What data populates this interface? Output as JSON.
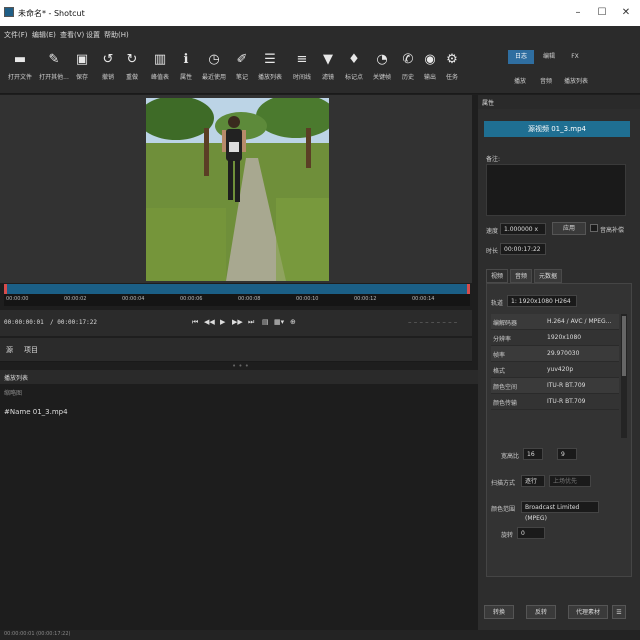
{
  "window": {
    "title": "未命名* - Shotcut"
  },
  "menu": [
    "文件(F)",
    "编辑(E)",
    "查看(V)",
    "设置",
    "帮助(H)"
  ],
  "toolbar": [
    {
      "label": "打开文件",
      "icon": "folder-icon"
    },
    {
      "label": "打开其他...",
      "icon": "open-other-icon"
    },
    {
      "label": "保存",
      "icon": "save-icon"
    },
    {
      "label": "撤销",
      "icon": "undo-icon"
    },
    {
      "label": "重做",
      "icon": "redo-icon"
    },
    {
      "label": "峰值表",
      "icon": "peak-meter-icon"
    },
    {
      "label": "属性",
      "icon": "info-icon"
    },
    {
      "label": "最近使用",
      "icon": "recent-icon"
    },
    {
      "label": "笔记",
      "icon": "notes-icon"
    },
    {
      "label": "播放列表",
      "icon": "playlist-icon"
    },
    {
      "label": "时间线",
      "icon": "timeline-icon"
    },
    {
      "label": "滤镜",
      "icon": "filter-icon"
    },
    {
      "label": "标记点",
      "icon": "marker-icon"
    },
    {
      "label": "关键帧",
      "icon": "keyframe-icon"
    },
    {
      "label": "历史",
      "icon": "history-icon"
    },
    {
      "label": "输出",
      "icon": "export-icon"
    },
    {
      "label": "任务",
      "icon": "jobs-icon"
    }
  ],
  "modes": {
    "tabs": [
      "日志",
      "编辑",
      "FX"
    ],
    "subs": [
      "播放",
      "音频",
      "播放列表"
    ]
  },
  "player": {
    "timecode_current": "00:00:00:01",
    "timecode_total": "/ 00:00:17:22",
    "ruler_labels": [
      "00:00:00",
      "00:00:02",
      "00:00:04",
      "00:00:06",
      "00:00:08",
      "00:00:10",
      "00:00:12",
      "00:00:14",
      "00:00:16"
    ]
  },
  "source_tabs": [
    "源",
    "项目"
  ],
  "playlist": {
    "title": "播放列表",
    "subtitle": "缩略图",
    "items": [
      "#Name 01_3.mp4"
    ]
  },
  "status": "00:00:00:01 (00:00:17:22)",
  "properties": {
    "title": "属性",
    "clip_name": "源视频 01_3.mp4",
    "notes_label": "备注:",
    "speed_label": "速度",
    "speed_value": "1.000000 x",
    "apply_btn": "应用",
    "pitch_label": "音高补偿",
    "duration_label": "时长",
    "duration_value": "00:00:17:22",
    "tabs": [
      "视频",
      "音频",
      "元数据"
    ],
    "track_label": "轨道",
    "track_value": "1: 1920x1080 H264",
    "info": [
      {
        "k": "编解码器",
        "v": "H.264 / AVC / MPEG..."
      },
      {
        "k": "分辨率",
        "v": "1920x1080"
      },
      {
        "k": "帧率",
        "v": "29.970030"
      },
      {
        "k": "格式",
        "v": "yuv420p"
      },
      {
        "k": "颜色空间",
        "v": "ITU-R BT.709"
      },
      {
        "k": "颜色传输",
        "v": "ITU-R BT.709"
      }
    ],
    "aspect_label": "宽高比",
    "aspect_a": "16",
    "aspect_b": "9",
    "scan_label": "扫描方式",
    "scan_value": "逐行",
    "scan_value2": "上场优先",
    "range_label": "颜色范围",
    "range_value": "Broadcast Limited (MPEG)",
    "rotation_label": "旋转",
    "rotation_value": "0",
    "bottom_buttons": [
      "转换",
      "反转",
      "代理素材"
    ]
  }
}
